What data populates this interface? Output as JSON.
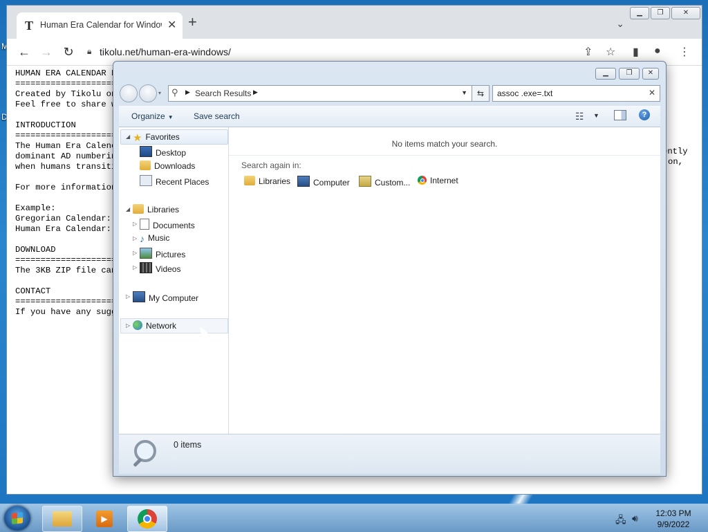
{
  "desktop": {
    "labels": [
      "M",
      "D"
    ]
  },
  "browser": {
    "tab_title": "Human Era Calendar for Windows",
    "tab_favicon": "T",
    "url": "tikolu.net/human-era-windows/",
    "window_controls": [
      "minimize",
      "maximize",
      "close"
    ],
    "page_text": "HUMAN ERA CALENDAR F\n====================\nCreated by Tikolu on\nFeel free to share w\n\nINTRODUCTION\n====================\nThe Human Era Calenc\ndominant AD numberin\nwhen humans transiti\n\nFor more information\n\nExample:\nGregorian Calendar:\nHuman Era Calendar:\n\nDOWNLOAD\n====================\nThe 3KB ZIP file can\n\nCONTACT\n====================\nIf you have any sugg",
    "page_text_right": [
      "ently",
      "on,"
    ]
  },
  "explorer": {
    "breadcrumb": "Search Results",
    "search_query": "assoc .exe=.txt",
    "toolbar": {
      "organize": "Organize",
      "save_search": "Save search"
    },
    "nav": {
      "favorites": "Favorites",
      "desktop": "Desktop",
      "downloads": "Downloads",
      "recent_places": "Recent Places",
      "libraries": "Libraries",
      "documents": "Documents",
      "music": "Music",
      "pictures": "Pictures",
      "videos": "Videos",
      "my_computer": "My Computer",
      "network": "Network"
    },
    "content": {
      "empty_message": "No items match your search.",
      "search_again_label": "Search again in:",
      "search_again_links": [
        "Libraries",
        "Computer",
        "Custom...",
        "Internet"
      ]
    },
    "details": {
      "count": "0 items"
    }
  },
  "taskbar": {
    "clock_time": "12:03 PM",
    "clock_date": "9/9/2022"
  }
}
